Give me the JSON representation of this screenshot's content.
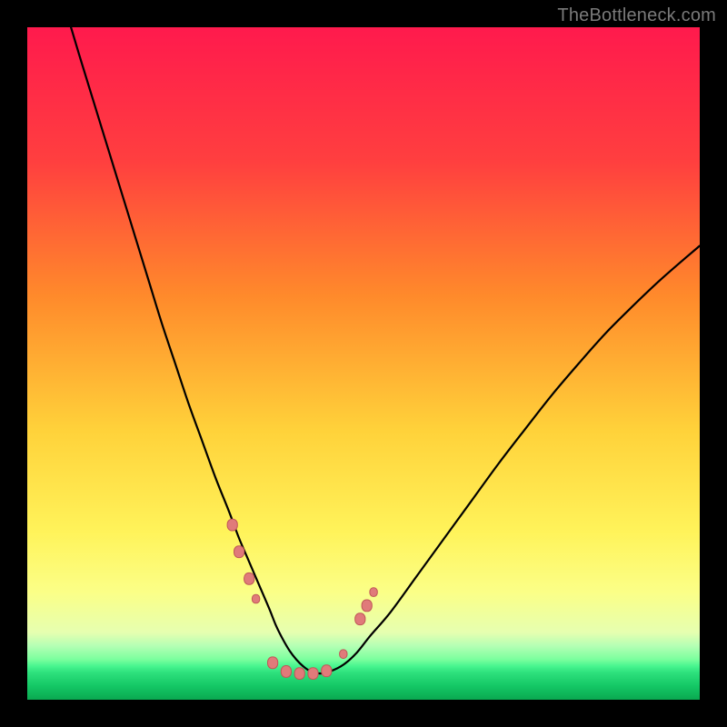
{
  "watermark": "TheBottleneck.com",
  "colors": {
    "page_bg": "#000000",
    "gradient_stops": [
      {
        "offset": 0.0,
        "color": "#ff1a4d"
      },
      {
        "offset": 0.2,
        "color": "#ff3f3f"
      },
      {
        "offset": 0.4,
        "color": "#ff8a2b"
      },
      {
        "offset": 0.6,
        "color": "#ffd23a"
      },
      {
        "offset": 0.75,
        "color": "#fff35a"
      },
      {
        "offset": 0.84,
        "color": "#fbff87"
      },
      {
        "offset": 0.9,
        "color": "#e6ffb0"
      },
      {
        "offset": 0.92,
        "color": "#b4ffb4"
      },
      {
        "offset": 0.94,
        "color": "#7bff9e"
      },
      {
        "offset": 0.95,
        "color": "#47f58f"
      },
      {
        "offset": 0.96,
        "color": "#2de07c"
      },
      {
        "offset": 0.98,
        "color": "#14c765"
      },
      {
        "offset": 1.0,
        "color": "#0aa850"
      }
    ],
    "curve_stroke": "#000000",
    "marker_fill": "#e07a7a",
    "marker_stroke": "#c05858"
  },
  "chart_data": {
    "type": "line",
    "title": "",
    "xlabel": "",
    "ylabel": "",
    "xlim": [
      0,
      100
    ],
    "ylim": [
      0,
      100
    ],
    "grid": false,
    "legend": false,
    "x": [
      6.5,
      8,
      10,
      12,
      14,
      16,
      18,
      20,
      22,
      24,
      26,
      28,
      30,
      31.5,
      33,
      34.5,
      36,
      37,
      38,
      39,
      40,
      41,
      42,
      43.5,
      45,
      47,
      49,
      51,
      54,
      58,
      62,
      66,
      70,
      74,
      78,
      82,
      86,
      90,
      94,
      98,
      100
    ],
    "y": [
      100,
      95,
      88.5,
      82,
      75.5,
      69,
      62.5,
      56,
      50,
      44,
      38.5,
      33,
      28,
      24,
      20.5,
      17,
      13.5,
      11,
      9,
      7.3,
      6,
      5,
      4.3,
      3.9,
      4.2,
      5.2,
      7,
      9.5,
      13,
      18.5,
      24,
      29.5,
      35,
      40.2,
      45.3,
      50,
      54.5,
      58.5,
      62.3,
      65.8,
      67.5
    ],
    "markers": [
      {
        "x": 30.5,
        "y": 26,
        "size": 8
      },
      {
        "x": 31.5,
        "y": 22,
        "size": 8
      },
      {
        "x": 33.0,
        "y": 18,
        "size": 8
      },
      {
        "x": 34.0,
        "y": 15,
        "size": 6
      },
      {
        "x": 36.5,
        "y": 5.5,
        "size": 8
      },
      {
        "x": 38.5,
        "y": 4.2,
        "size": 8
      },
      {
        "x": 40.5,
        "y": 3.9,
        "size": 8
      },
      {
        "x": 42.5,
        "y": 3.9,
        "size": 8
      },
      {
        "x": 44.5,
        "y": 4.3,
        "size": 8
      },
      {
        "x": 47.0,
        "y": 6.8,
        "size": 6
      },
      {
        "x": 49.5,
        "y": 12,
        "size": 8
      },
      {
        "x": 50.5,
        "y": 14,
        "size": 8
      },
      {
        "x": 51.5,
        "y": 16,
        "size": 6
      }
    ]
  }
}
